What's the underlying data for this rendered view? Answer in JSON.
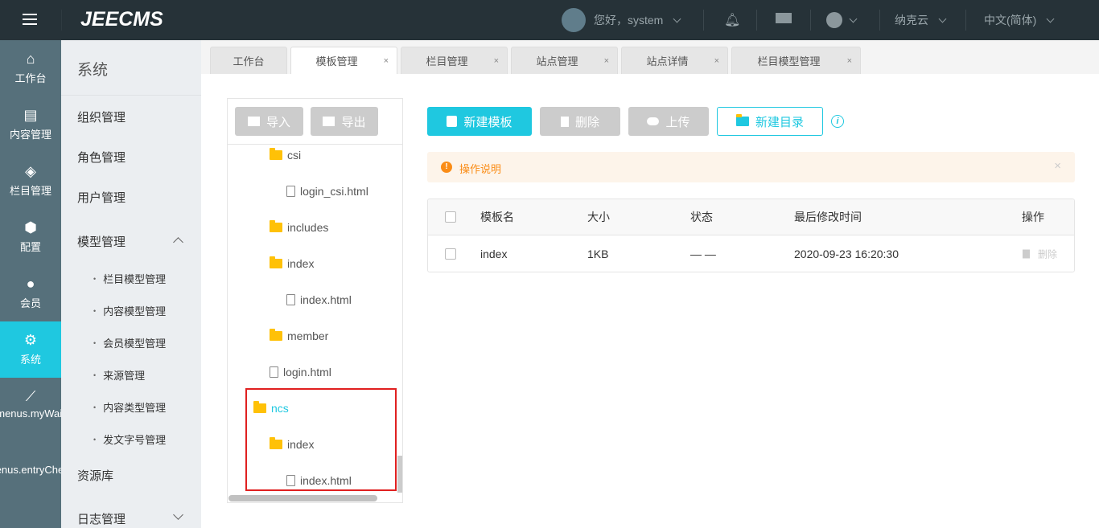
{
  "header": {
    "logo": "JEECMS",
    "greeting": "您好，system",
    "site": "纳克云",
    "language": "中文(简体)"
  },
  "nav": [
    {
      "label": "工作台",
      "icon": "home-icon"
    },
    {
      "label": "内容管理",
      "icon": "document-icon"
    },
    {
      "label": "栏目管理",
      "icon": "layers-icon"
    },
    {
      "label": "配置",
      "icon": "cube-icon"
    },
    {
      "label": "会员",
      "icon": "user-icon"
    },
    {
      "label": "系统",
      "icon": "gear-icon"
    },
    {
      "label": "menus.myWait",
      "icon": "chart-icon"
    },
    {
      "label": "menus.entryCheck"
    }
  ],
  "sub": {
    "title": "系统",
    "items": [
      "组织管理",
      "角色管理",
      "用户管理"
    ],
    "model": "模型管理",
    "model_children": [
      "栏目模型管理",
      "内容模型管理",
      "会员模型管理",
      "来源管理",
      "内容类型管理",
      "发文字号管理"
    ],
    "resources": "资源库",
    "logs": "日志管理"
  },
  "tabs": [
    {
      "label": "工作台"
    },
    {
      "label": "模板管理"
    },
    {
      "label": "栏目管理"
    },
    {
      "label": "站点管理"
    },
    {
      "label": "站点详情"
    },
    {
      "label": "栏目模型管理"
    }
  ],
  "tab_close": "×",
  "tree": {
    "import": "导入",
    "export": "导出",
    "nodes": [
      {
        "label": "csi",
        "type": "folder"
      },
      {
        "label": "login_csi.html",
        "type": "file"
      },
      {
        "label": "includes",
        "type": "folder"
      },
      {
        "label": "index",
        "type": "folder"
      },
      {
        "label": "index.html",
        "type": "file"
      },
      {
        "label": "member",
        "type": "folder"
      },
      {
        "label": "login.html",
        "type": "file"
      },
      {
        "label": "ncs",
        "type": "folder"
      },
      {
        "label": "index",
        "type": "folder"
      },
      {
        "label": "index.html",
        "type": "file"
      }
    ]
  },
  "toolbar": {
    "new_template": "新建模板",
    "delete": "删除",
    "upload": "上传",
    "new_dir": "新建目录"
  },
  "alert": {
    "text": "操作说明",
    "close": "×"
  },
  "table": {
    "headers": [
      "模板名",
      "大小",
      "状态",
      "最后修改时间",
      "操作"
    ],
    "rows": [
      {
        "name": "index",
        "size": "1KB",
        "status": "— —",
        "modified": "2020-09-23 16:20:30",
        "action": "删除"
      }
    ]
  },
  "colors": {
    "accent": "#1fc8e0",
    "topbar": "#263238",
    "nav": "#56707b",
    "warning": "#fa8c16"
  }
}
